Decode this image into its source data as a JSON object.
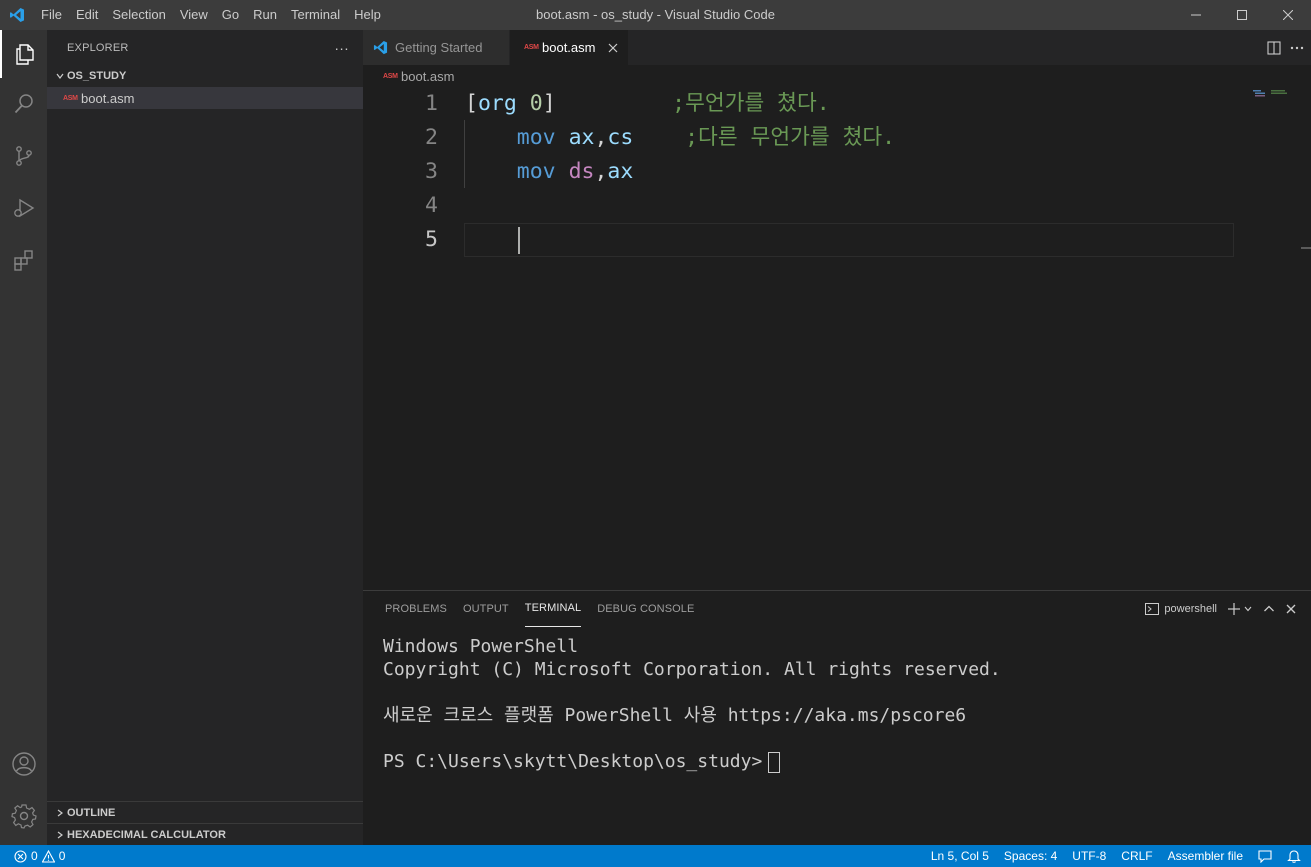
{
  "titlebar": {
    "menu": [
      "File",
      "Edit",
      "Selection",
      "View",
      "Go",
      "Run",
      "Terminal",
      "Help"
    ],
    "window_title": "boot.asm - os_study - Visual Studio Code"
  },
  "sidebar": {
    "header": "EXPLORER",
    "more_label": "···",
    "folder": "OS_STUDY",
    "file": {
      "badge": "ASM",
      "name": "boot.asm"
    },
    "sections": [
      "OUTLINE",
      "HEXADECIMAL CALCULATOR"
    ]
  },
  "editor": {
    "tabs": [
      {
        "label": "Getting Started",
        "icon": "vscode-logo-icon"
      },
      {
        "label": "boot.asm",
        "badge": "ASM"
      }
    ],
    "breadcrumb": {
      "badge": "ASM",
      "file": "boot.asm"
    },
    "lines": [
      {
        "number": "1",
        "tokens": [
          [
            "[",
            "bracket"
          ],
          [
            "org",
            "reg"
          ],
          [
            " ",
            "punc"
          ],
          [
            "0",
            "num"
          ],
          [
            "]",
            "bracket"
          ],
          [
            "         ",
            "punc"
          ],
          [
            ";무언가를 쳤다.",
            "comment"
          ]
        ]
      },
      {
        "number": "2",
        "tokens": [
          [
            "    ",
            "punc"
          ],
          [
            "mov",
            "kw"
          ],
          [
            " ",
            "punc"
          ],
          [
            "ax",
            "reg"
          ],
          [
            ",",
            "punc"
          ],
          [
            "cs",
            "reg"
          ],
          [
            "    ",
            "punc"
          ],
          [
            ";다른 무언가를 쳤다.",
            "comment"
          ]
        ]
      },
      {
        "number": "3",
        "tokens": [
          [
            "    ",
            "punc"
          ],
          [
            "mov",
            "kw"
          ],
          [
            " ",
            "punc"
          ],
          [
            "ds",
            "seg"
          ],
          [
            ",",
            "punc"
          ],
          [
            "ax",
            "reg"
          ]
        ]
      },
      {
        "number": "4",
        "tokens": []
      },
      {
        "number": "5",
        "tokens": []
      }
    ]
  },
  "panel": {
    "tabs": [
      "PROBLEMS",
      "OUTPUT",
      "TERMINAL",
      "DEBUG CONSOLE"
    ],
    "active_tab": "TERMINAL",
    "terminal_name": "powershell",
    "terminal_lines": [
      "Windows PowerShell",
      "Copyright (C) Microsoft Corporation. All rights reserved.",
      "",
      "새로운 크로스 플랫폼 PowerShell 사용 https://aka.ms/pscore6",
      "",
      "PS C:\\Users\\skytt\\Desktop\\os_study>"
    ]
  },
  "statusbar": {
    "errors": "0",
    "warnings": "0",
    "position": "Ln 5, Col 5",
    "spaces": "Spaces: 4",
    "encoding": "UTF-8",
    "eol": "CRLF",
    "language": "Assembler file"
  },
  "colors": {
    "accent": "#007acc",
    "comment": "#6a9955",
    "keyword": "#569cd6",
    "register": "#9cdcfe",
    "segment": "#c586c0"
  }
}
